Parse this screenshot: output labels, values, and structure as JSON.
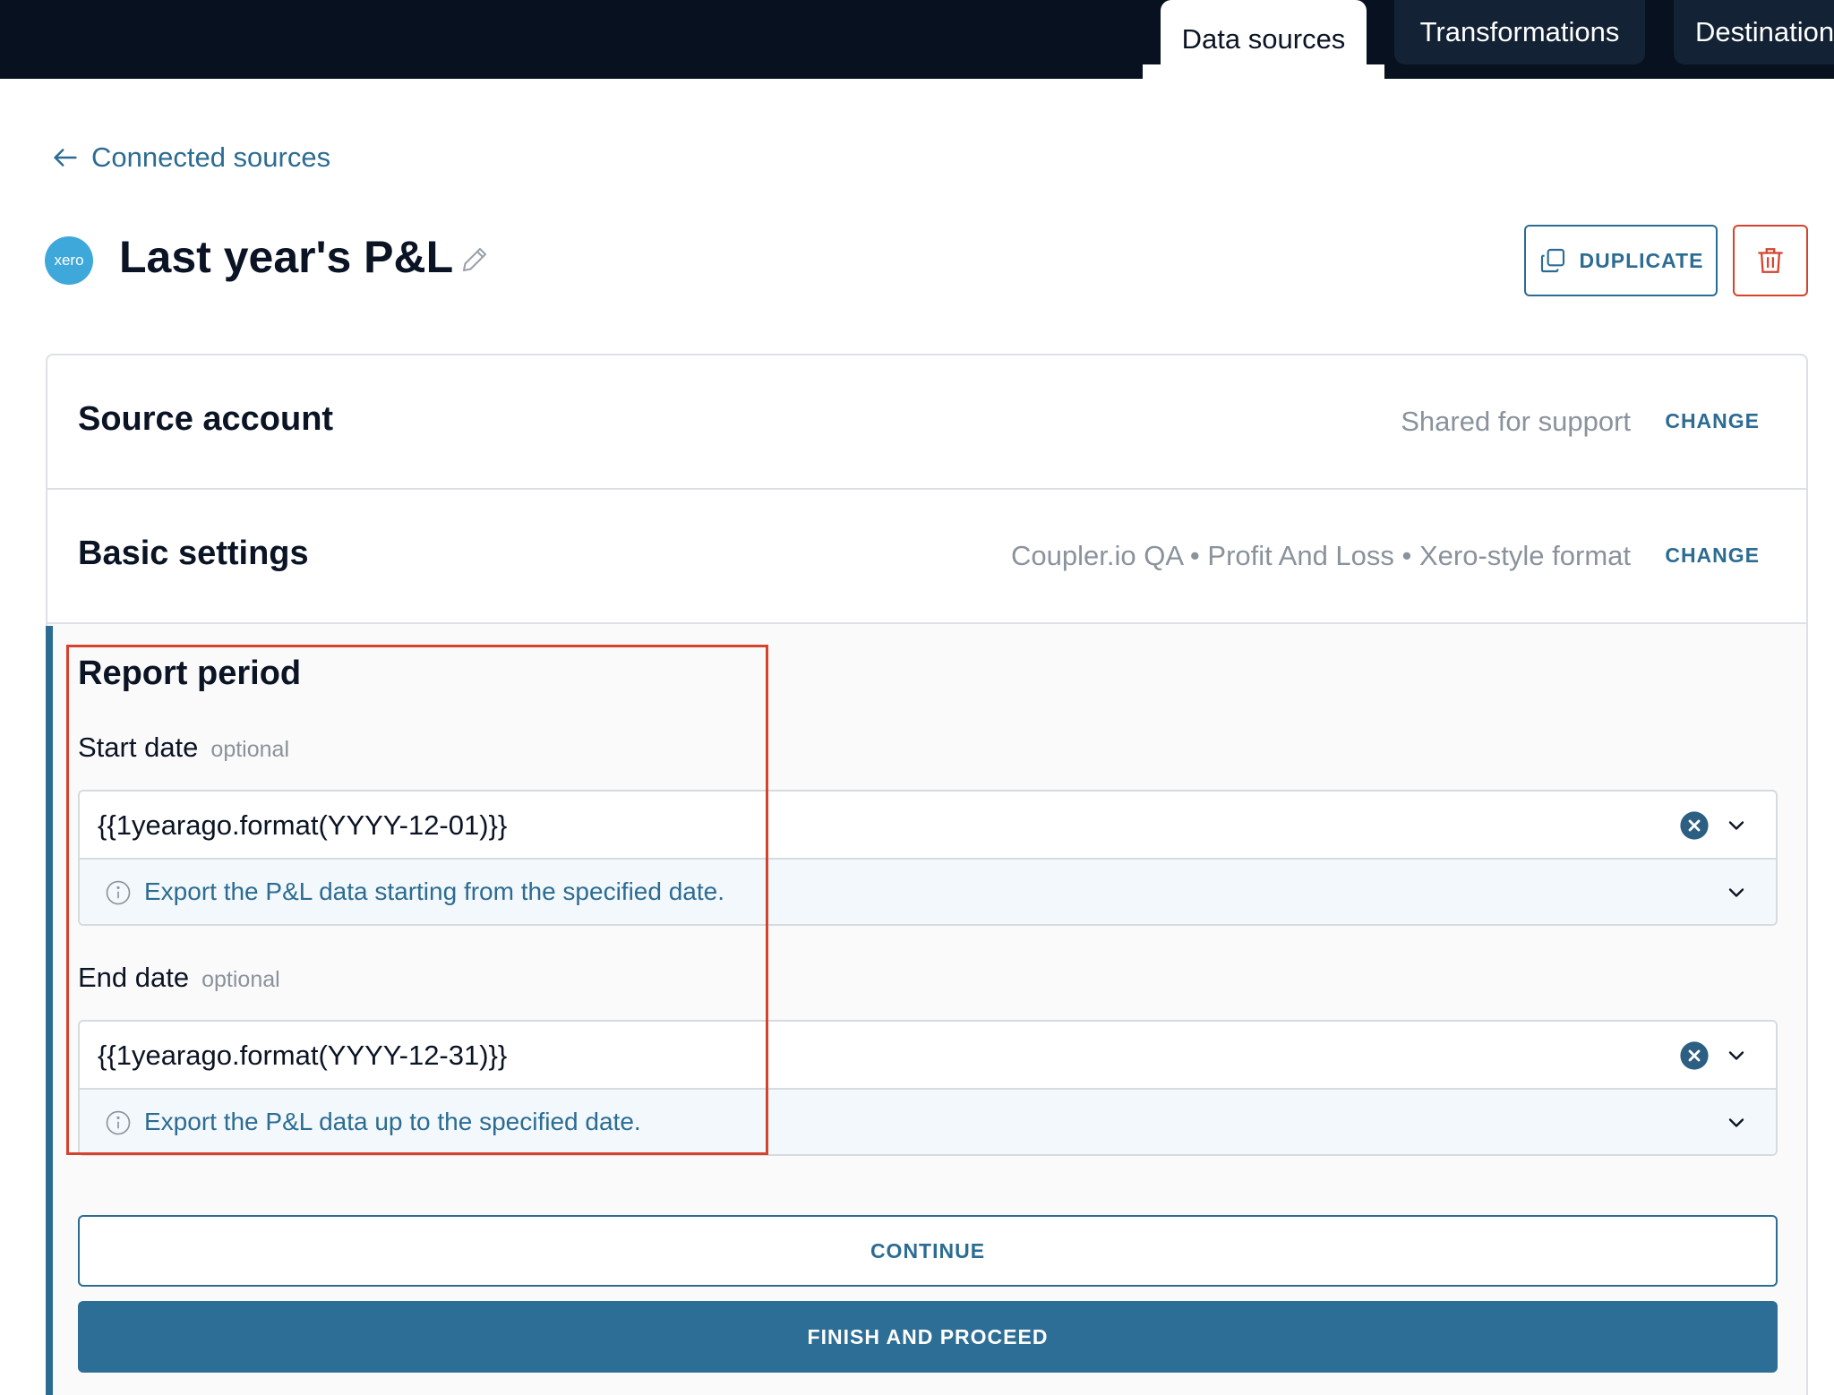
{
  "nav": {
    "tabs": [
      {
        "label": "Data sources",
        "active": true
      },
      {
        "label": "Transformations",
        "active": false
      },
      {
        "label": "Destinations",
        "active": false
      }
    ]
  },
  "back_link": {
    "label": "Connected sources",
    "icon": "arrow-left-icon"
  },
  "header": {
    "logo_text": "xero",
    "title": "Last year's P&L",
    "duplicate_label": "DUPLICATE"
  },
  "sections": {
    "source_account": {
      "title": "Source account",
      "summary": "Shared for support",
      "action": "CHANGE"
    },
    "basic_settings": {
      "title": "Basic settings",
      "summary": "Coupler.io QA • Profit And Loss • Xero-style format",
      "action": "CHANGE"
    }
  },
  "report_period": {
    "title": "Report period",
    "start": {
      "label": "Start date",
      "optional": "optional",
      "value": "{{1yearago.format(YYYY-12-01)}}",
      "hint": "Export the P&L data starting from the specified date."
    },
    "end": {
      "label": "End date",
      "optional": "optional",
      "value": "{{1yearago.format(YYYY-12-31)}}",
      "hint": "Export the P&L data up to the specified date."
    }
  },
  "actions": {
    "continue_label": "CONTINUE",
    "finish_label": "FINISH AND PROCEED"
  },
  "colors": {
    "accent": "#2c6c93",
    "danger": "#d5432d",
    "topbar": "#07111f",
    "xero": "#3fa8da"
  }
}
